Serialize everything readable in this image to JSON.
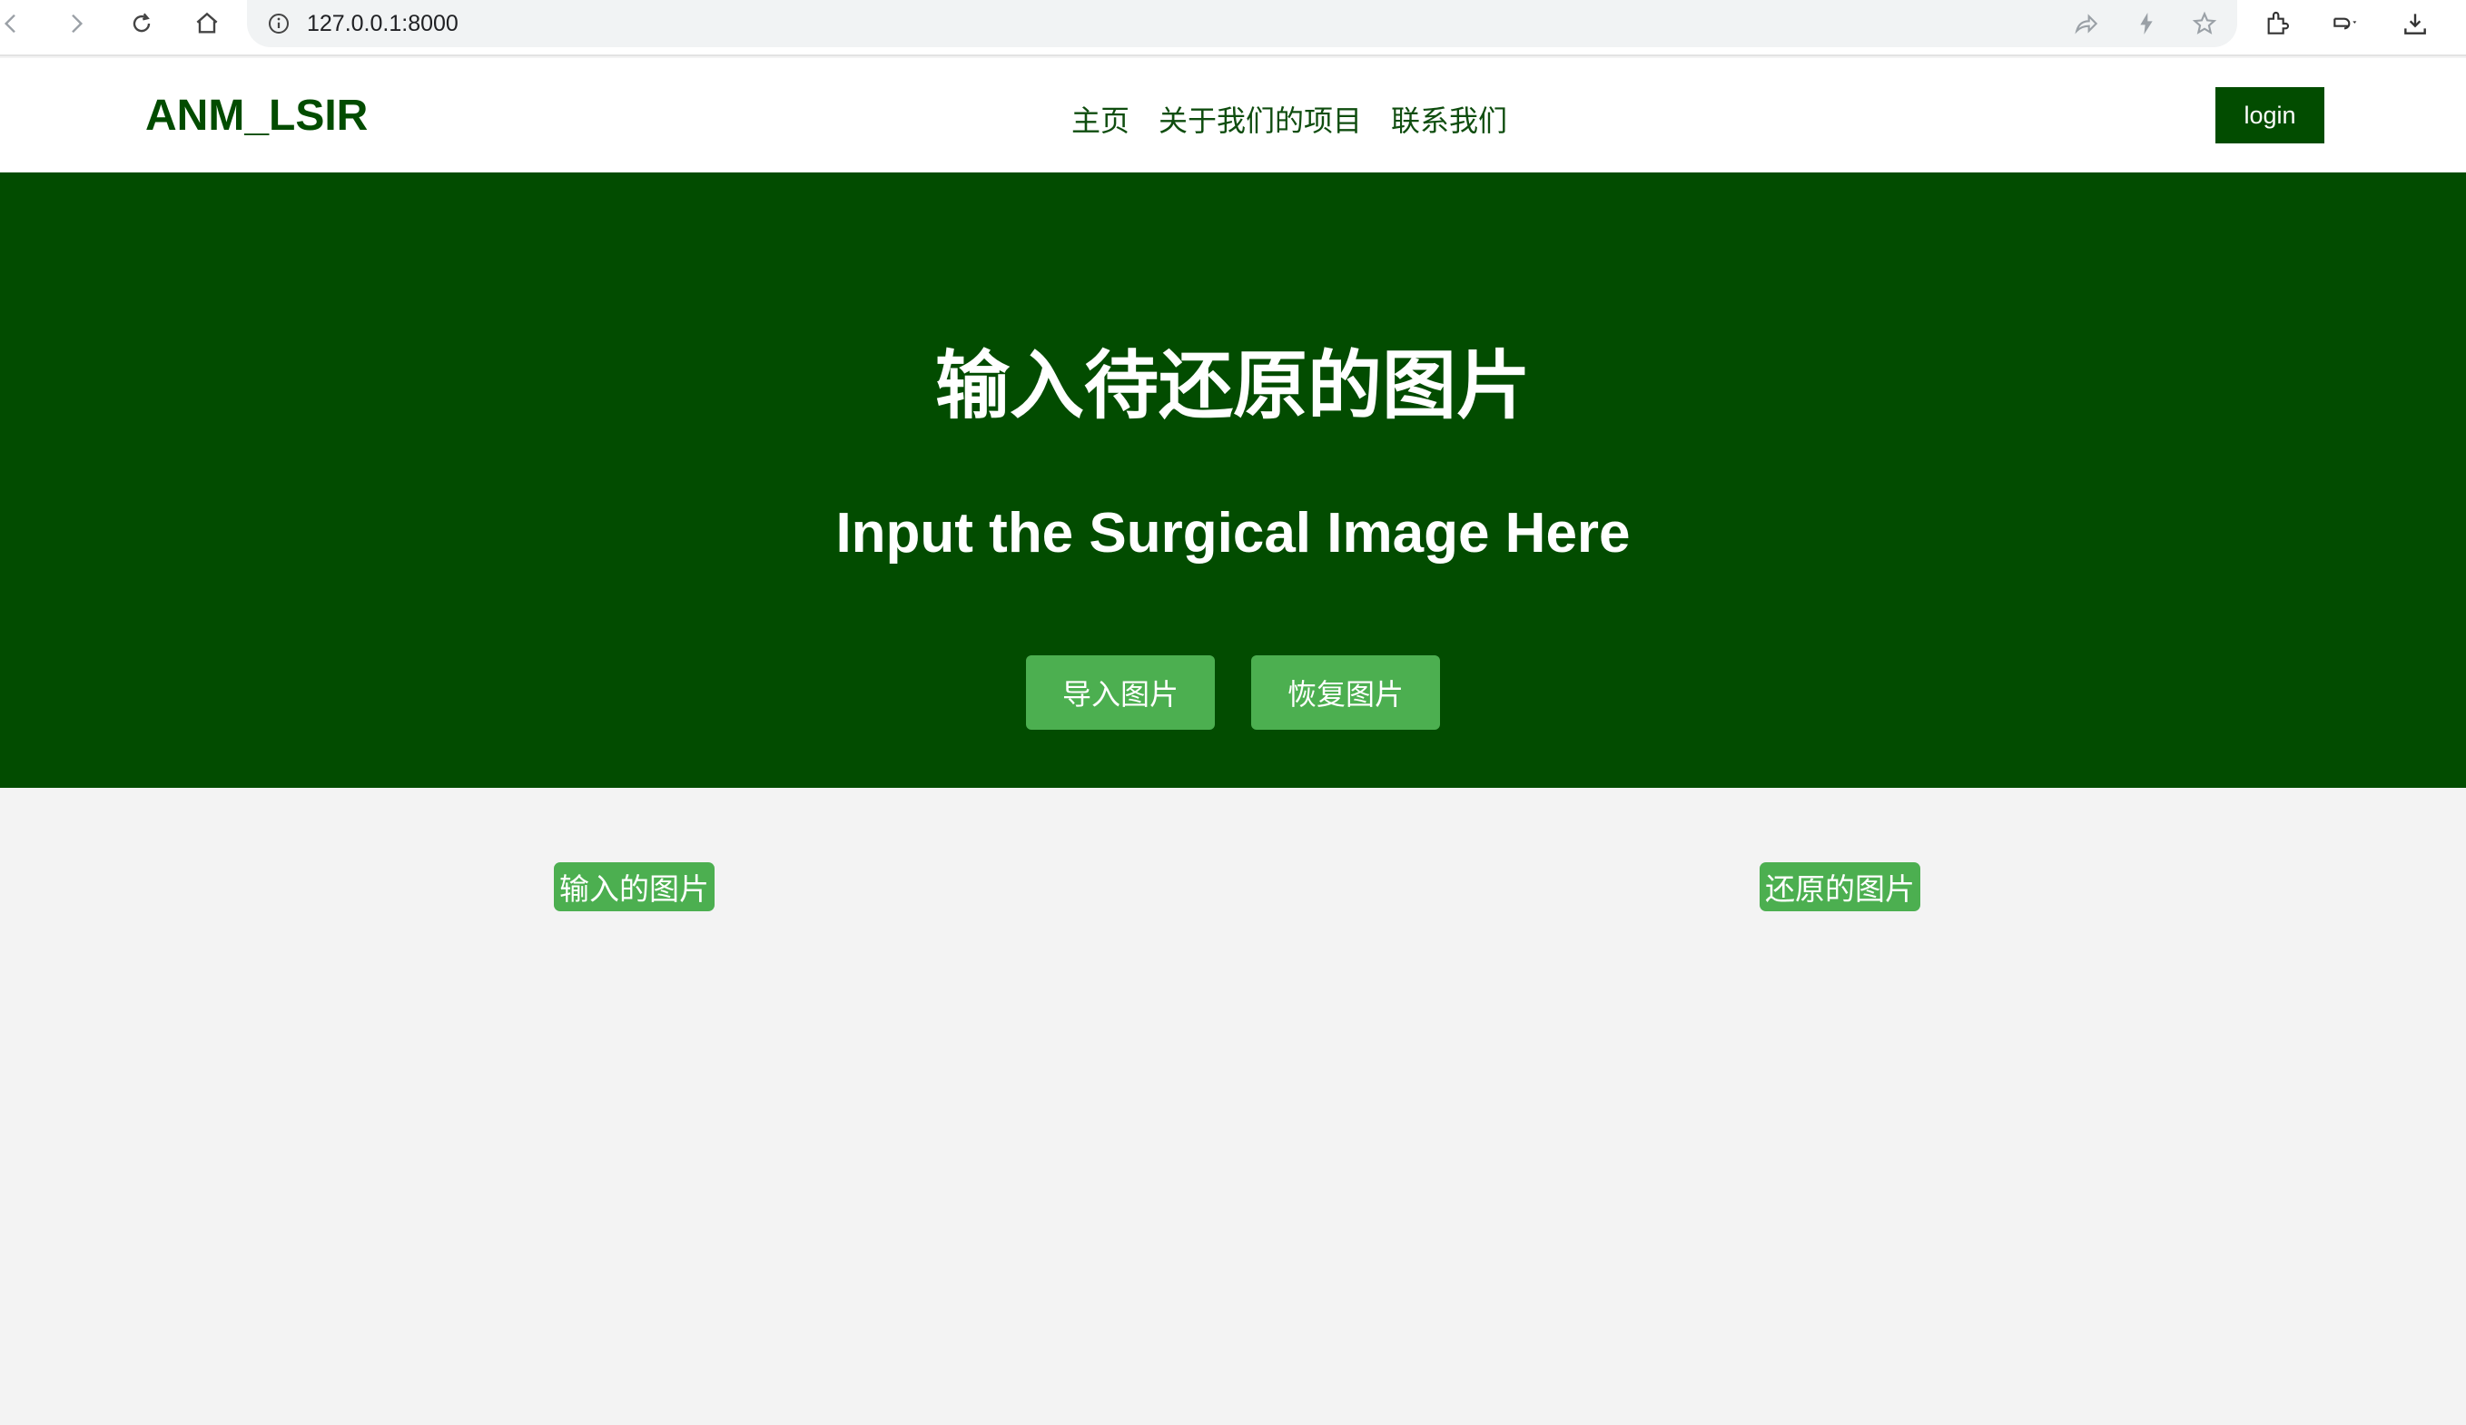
{
  "browser": {
    "url": "127.0.0.1:8000",
    "icons": [
      "back-icon",
      "forward-icon",
      "reload-icon",
      "home-icon",
      "info-icon",
      "share-icon",
      "lightning-icon",
      "star-icon",
      "extensions-icon",
      "undo-icon",
      "download-icon"
    ]
  },
  "header": {
    "logo": "ANM_LSIR",
    "nav": [
      "主页",
      "关于我们的项目",
      "联系我们"
    ],
    "login_label": "login"
  },
  "hero": {
    "title": "输入待还原的图片",
    "subtitle": "Input the Surgical Image Here",
    "import_button": "导入图片",
    "restore_button": "恢复图片",
    "background_color": "#024c00",
    "button_color": "#4caf50"
  },
  "content": {
    "input_label": "输入的图片",
    "output_label": "还原的图片"
  }
}
